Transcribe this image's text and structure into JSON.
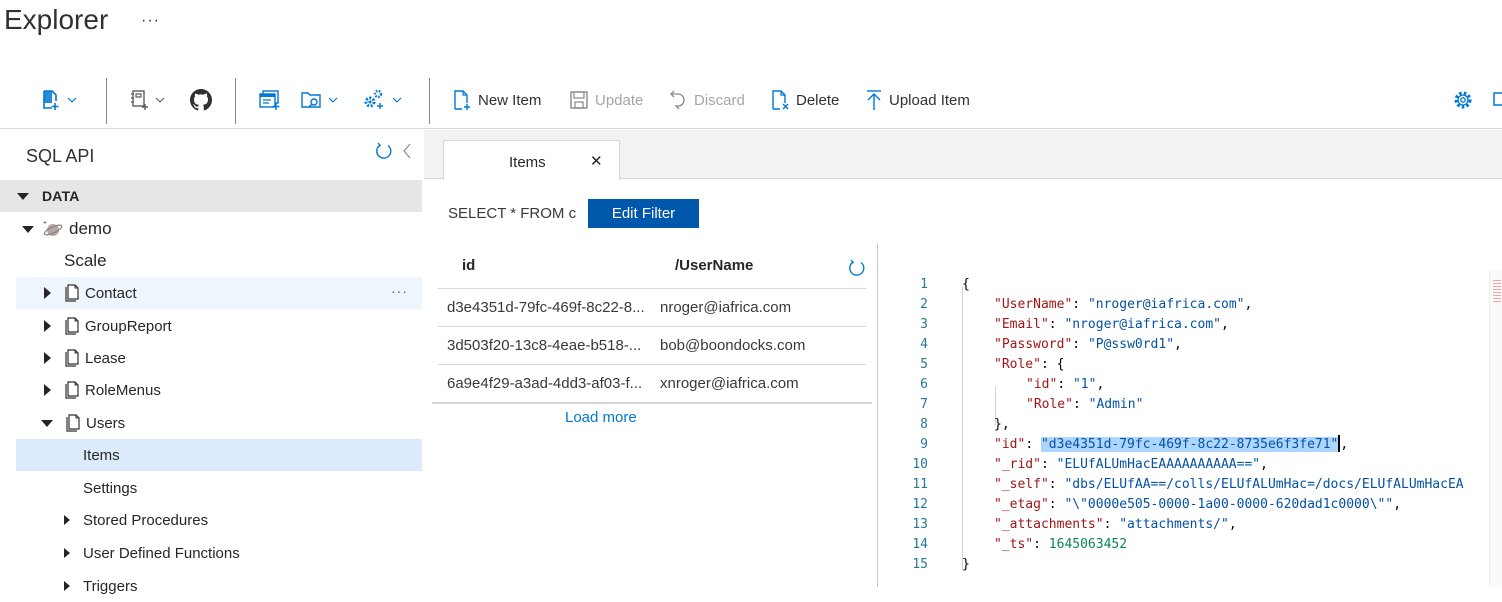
{
  "header": {
    "title": "Explorer",
    "more_label": "···"
  },
  "toolbar": {
    "new_item": "New Item",
    "update": "Update",
    "discard": "Discard",
    "delete": "Delete",
    "upload_item": "Upload Item"
  },
  "sidebar": {
    "title": "SQL API",
    "section": "DATA",
    "database": "demo",
    "scale": "Scale",
    "containers": [
      "Contact",
      "GroupReport",
      "Lease",
      "RoleMenus",
      "Users"
    ],
    "container_more": "···",
    "users_children": [
      "Items",
      "Settings",
      "Stored Procedures",
      "User Defined Functions",
      "Triggers"
    ]
  },
  "tabs": [
    {
      "label": "Items",
      "close": "✕"
    }
  ],
  "query": {
    "text": "SELECT * FROM c",
    "edit_filter": "Edit Filter"
  },
  "grid": {
    "columns": [
      "id",
      "/UserName"
    ],
    "rows": [
      {
        "id": "d3e4351d-79fc-469f-8c22-8...",
        "user": "nroger@iafrica.com"
      },
      {
        "id": "3d503f20-13c8-4eae-b518-...",
        "user": "bob@boondocks.com"
      },
      {
        "id": "6a9e4f29-a3ad-4dd3-af03-f...",
        "user": "xnroger@iafrica.com"
      }
    ],
    "load_more": "Load more"
  },
  "document": {
    "line_numbers": [
      "1",
      "2",
      "3",
      "4",
      "5",
      "6",
      "7",
      "8",
      "9",
      "10",
      "11",
      "12",
      "13",
      "14",
      "15"
    ],
    "fields": {
      "username_key": "\"UserName\"",
      "username_val": "\"nroger@iafrica.com\"",
      "email_key": "\"Email\"",
      "email_val": "\"nroger@iafrica.com\"",
      "password_key": "\"Password\"",
      "password_val": "\"P@ssw0rd1\"",
      "role_key": "\"Role\"",
      "role_id_key": "\"id\"",
      "role_id_val": "\"1\"",
      "role_role_key": "\"Role\"",
      "role_role_val": "\"Admin\"",
      "id_key": "\"id\"",
      "id_val": "\"d3e4351d-79fc-469f-8c22-8735e6f3fe71\"",
      "rid_key": "\"_rid\"",
      "rid_val": "\"ELUfALUmHacEAAAAAAAAAA==\"",
      "self_key": "\"_self\"",
      "self_val": "\"dbs/ELUfAA==/colls/ELUfALUmHac=/docs/ELUfALUmHacEA",
      "etag_key": "\"_etag\"",
      "etag_val": "\"\\\"0000e505-0000-1a00-0000-620dad1c0000\\\"\"",
      "attach_key": "\"_attachments\"",
      "attach_val": "\"attachments/\"",
      "ts_key": "\"_ts\"",
      "ts_val": "1645063452"
    }
  },
  "colors": {
    "accent": "#0078d4",
    "button": "#0058ad",
    "selected": "#dbebfb"
  }
}
